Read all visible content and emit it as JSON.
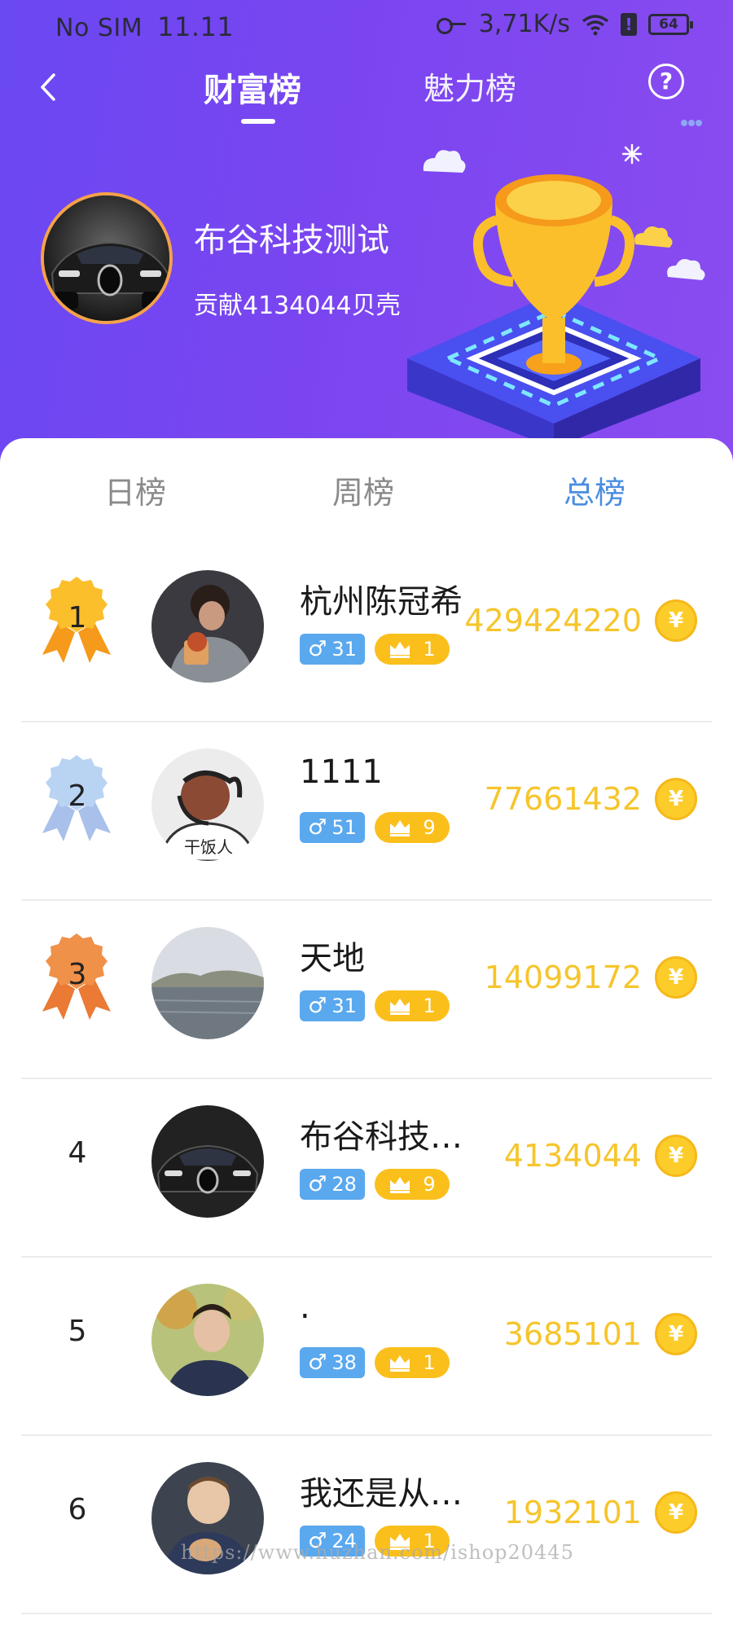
{
  "status_bar": {
    "carrier": "No SIM",
    "time": "11.11",
    "net_speed": "3,71K/s",
    "battery": "64"
  },
  "nav": {
    "tab_wealth": "财富榜",
    "tab_charm": "魅力榜",
    "help": "?"
  },
  "top_user": {
    "name": "布谷科技测试",
    "contribution": "贡献4134044贝壳"
  },
  "period_tabs": {
    "day": "日榜",
    "week": "周榜",
    "total": "总榜",
    "active": "total"
  },
  "colors": {
    "header_start": "#6a48f2",
    "header_end": "#8a4cf0",
    "active_tab": "#4a8de0",
    "score": "#f6c52c",
    "gender_badge": "#5aa8ee",
    "level_badge": "#fbbf1c",
    "gold_medal": "#fbbf2c",
    "silver_medal": "#b9d3f3",
    "bronze_medal": "#f0914a"
  },
  "ranking": [
    {
      "rank": "1",
      "name": "杭州陈冠希",
      "gender": "♂",
      "age": "31",
      "level": "1",
      "score": "429424220",
      "medal": "gold",
      "avatar": "photo-boy-eating"
    },
    {
      "rank": "2",
      "name": "1111",
      "gender": "♂",
      "age": "51",
      "level": "9",
      "score": "77661432",
      "medal": "silver",
      "avatar": "cartoon-cap"
    },
    {
      "rank": "3",
      "name": "天地",
      "gender": "♂",
      "age": "31",
      "level": "1",
      "score": "14099172",
      "medal": "bronze",
      "avatar": "lake-landscape"
    },
    {
      "rank": "4",
      "name": "布谷科技…",
      "gender": "♂",
      "age": "28",
      "level": "9",
      "score": "4134044",
      "medal": "",
      "avatar": "black-sports-car"
    },
    {
      "rank": "5",
      "name": ".",
      "gender": "♂",
      "age": "38",
      "level": "1",
      "score": "3685101",
      "medal": "",
      "avatar": "photo-young-man"
    },
    {
      "rank": "6",
      "name": "我还是从…",
      "gender": "♂",
      "age": "24",
      "level": "1",
      "score": "1932101",
      "medal": "",
      "avatar": "photo-child-with-pet"
    }
  ],
  "coin_symbol": "¥",
  "watermark": "https://www.huzhan.com/ishop20445"
}
